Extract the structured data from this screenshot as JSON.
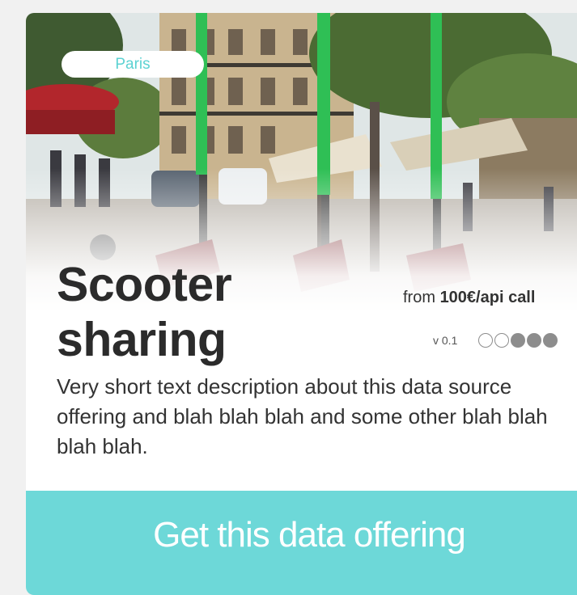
{
  "card": {
    "city_label": "Paris",
    "title": "Scooter sharing",
    "price_prefix": "from ",
    "price_amount": "100€/api call",
    "version": "v 0.1",
    "rating": {
      "filled": 3,
      "total": 5
    },
    "description": "Very short text description about this data source offering and blah blah blah and some other blah blah blah blah.",
    "cta_label": "Get this data offering",
    "image_subject": "street-with-green-scooters-photo"
  },
  "colors": {
    "accent": "#6dd8d8",
    "city_text": "#5cd2d2",
    "title_text": "#2b2b2b",
    "dot": "#8d8d8d",
    "background": "#f1f1f1"
  }
}
